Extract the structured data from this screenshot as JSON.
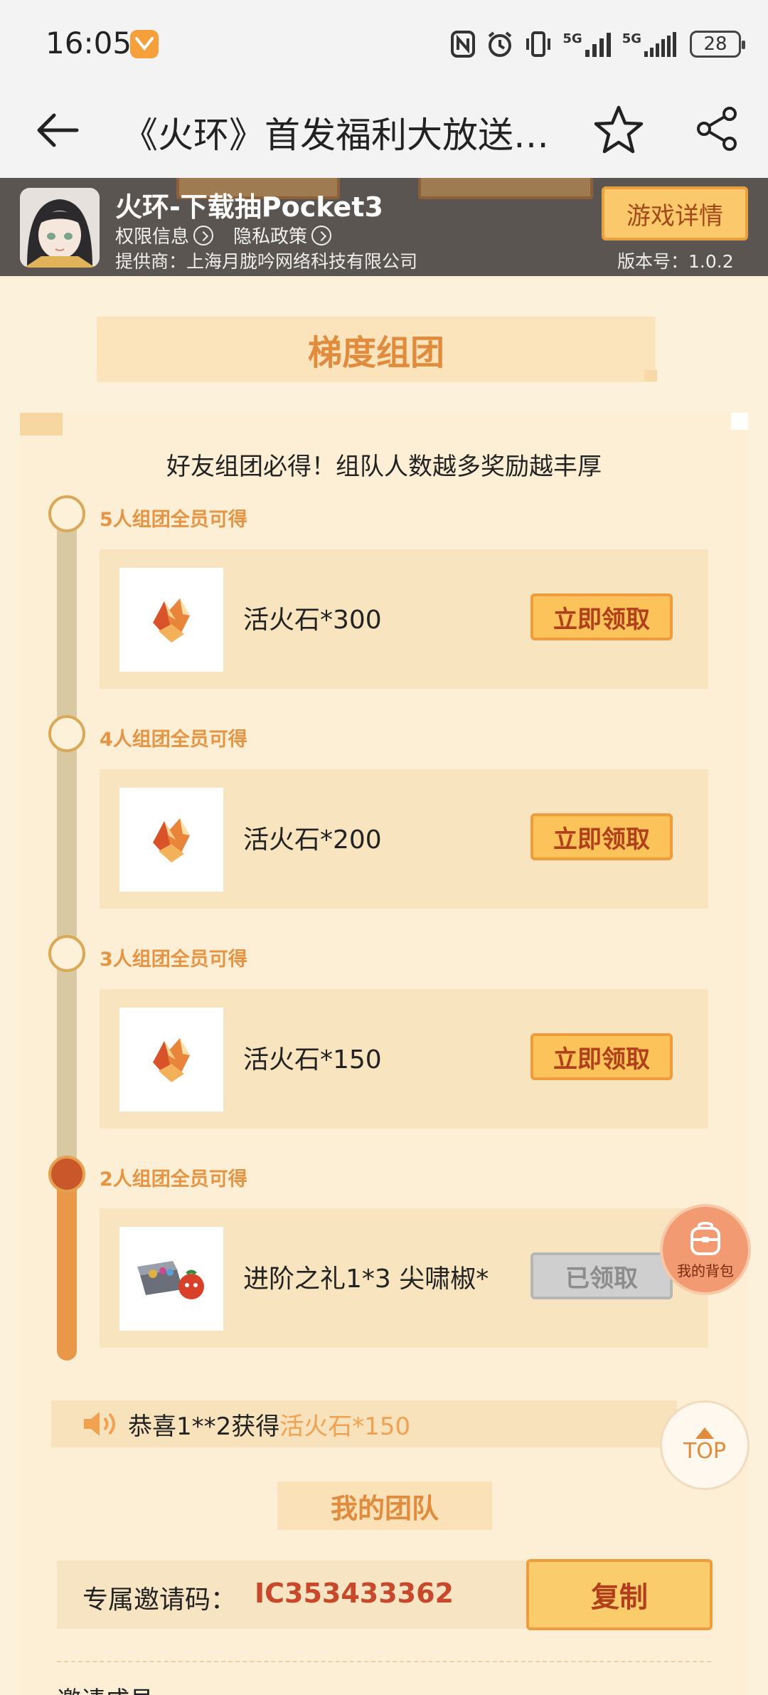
{
  "status_bar": {
    "time": "16:05",
    "network_1": "5G",
    "network_2": "5G",
    "battery": "28"
  },
  "nav": {
    "title": "《火环》首发福利大放送…"
  },
  "game": {
    "name": "火环-下载抽Pocket3",
    "permission_link": "权限信息",
    "privacy_link": "隐私政策",
    "provider": "提供商：上海月胧吟网络科技有限公司",
    "detail_button": "游戏详情",
    "version": "版本号：1.0.2"
  },
  "section": {
    "title": "梯度组团",
    "subtitle": "好友组团必得！组队人数越多奖励越丰厚"
  },
  "tiers": [
    {
      "label": "5人组团全员可得",
      "reward": "活火石*300",
      "button": "立即领取",
      "claimed": false
    },
    {
      "label": "4人组团全员可得",
      "reward": "活火石*200",
      "button": "立即领取",
      "claimed": false
    },
    {
      "label": "3人组团全员可得",
      "reward": "活火石*150",
      "button": "立即领取",
      "claimed": false
    },
    {
      "label": "2人组团全员可得",
      "reward": "进阶之礼1*3   尖啸椒*",
      "button": "已领取",
      "claimed": true
    }
  ],
  "floating": {
    "bag_label": "我的背包",
    "top_label": "TOP"
  },
  "notice": {
    "prefix": "恭喜1**2获得",
    "highlight": "活火石*150"
  },
  "team": {
    "title": "我的团队",
    "invite_label": "专属邀请码：",
    "invite_code": "IC353433362",
    "copy_button": "复制",
    "cut_text": "邀请成员"
  },
  "colors": {
    "accent": "#e08c3c",
    "button_fill": "#fbc359",
    "button_text": "#b13f1b",
    "page_bg": "#fcf1da"
  }
}
